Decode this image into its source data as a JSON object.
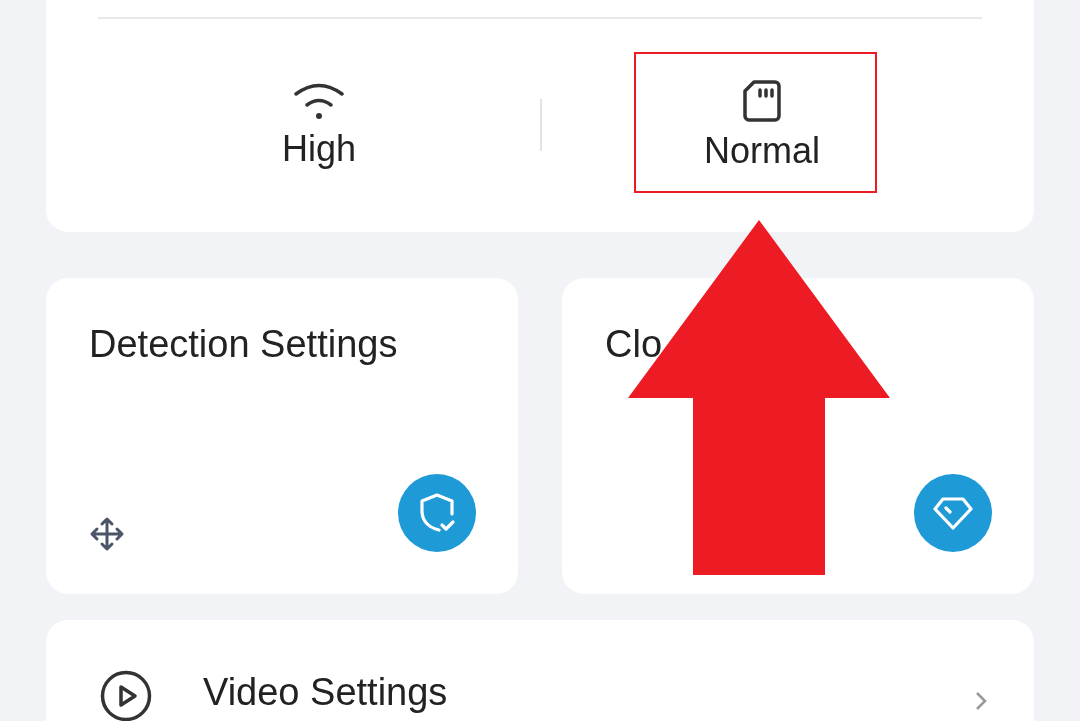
{
  "quality": [
    {
      "kind": "wifi",
      "label": "High"
    },
    {
      "kind": "sdcard",
      "label": "Normal"
    }
  ],
  "cards": [
    {
      "kind": "detection",
      "title_parts": [
        "Detection Settings"
      ]
    },
    {
      "kind": "cloud",
      "title_parts": [
        "Clo"
      ]
    }
  ],
  "menu": [
    {
      "kind": "video",
      "label": "Video Settings"
    }
  ]
}
